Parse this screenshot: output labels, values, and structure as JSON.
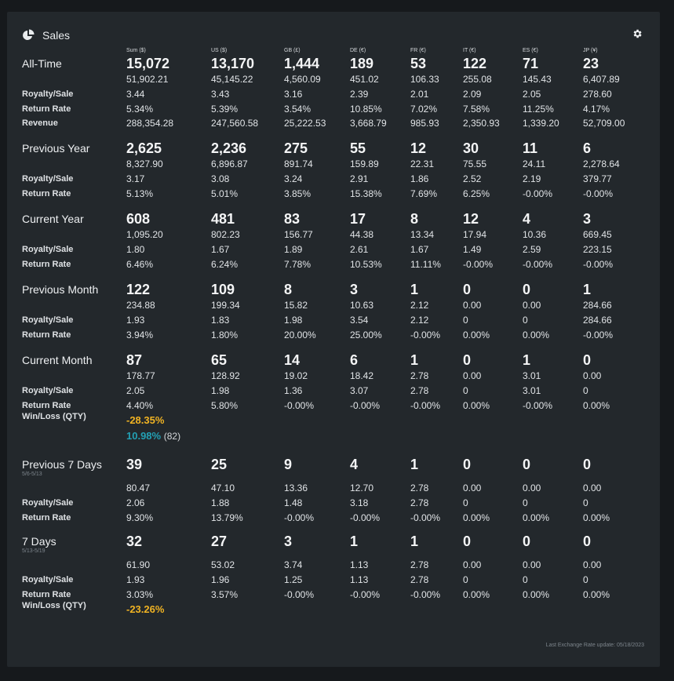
{
  "header": {
    "title": "Sales"
  },
  "columns": [
    "Sum ($)",
    "US ($)",
    "GB (£)",
    "DE (€)",
    "FR (€)",
    "IT (€)",
    "ES (€)",
    "JP (¥)"
  ],
  "groups": [
    {
      "name": "All-Time",
      "sub": "",
      "qty": [
        "15,072",
        "13,170",
        "1,444",
        "189",
        "53",
        "122",
        "71",
        "23"
      ],
      "royalty": [
        "51,902.21",
        "45,145.22",
        "4,560.09",
        "451.02",
        "106.33",
        "255.08",
        "145.43",
        "6,407.89"
      ],
      "rows": [
        {
          "label": "Royalty/Sale",
          "values": [
            "3.44",
            "3.43",
            "3.16",
            "2.39",
            "2.01",
            "2.09",
            "2.05",
            "278.60"
          ]
        },
        {
          "label": "Return Rate",
          "values": [
            "5.34%",
            "5.39%",
            "3.54%",
            "10.85%",
            "7.02%",
            "7.58%",
            "11.25%",
            "4.17%"
          ]
        },
        {
          "label": "Revenue",
          "values": [
            "288,354.28",
            "247,560.58",
            "25,222.53",
            "3,668.79",
            "985.93",
            "2,350.93",
            "1,339.20",
            "52,709.00"
          ]
        }
      ]
    },
    {
      "name": "Previous Year",
      "sub": "",
      "qty": [
        "2,625",
        "2,236",
        "275",
        "55",
        "12",
        "30",
        "11",
        "6"
      ],
      "royalty": [
        "8,327.90",
        "6,896.87",
        "891.74",
        "159.89",
        "22.31",
        "75.55",
        "24.11",
        "2,278.64"
      ],
      "rows": [
        {
          "label": "Royalty/Sale",
          "values": [
            "3.17",
            "3.08",
            "3.24",
            "2.91",
            "1.86",
            "2.52",
            "2.19",
            "379.77"
          ]
        },
        {
          "label": "Return Rate",
          "values": [
            "5.13%",
            "5.01%",
            "3.85%",
            "15.38%",
            "7.69%",
            "6.25%",
            "-0.00%",
            "-0.00%"
          ]
        }
      ]
    },
    {
      "name": "Current Year",
      "sub": "",
      "qty": [
        "608",
        "481",
        "83",
        "17",
        "8",
        "12",
        "4",
        "3"
      ],
      "royalty": [
        "1,095.20",
        "802.23",
        "156.77",
        "44.38",
        "13.34",
        "17.94",
        "10.36",
        "669.45"
      ],
      "rows": [
        {
          "label": "Royalty/Sale",
          "values": [
            "1.80",
            "1.67",
            "1.89",
            "2.61",
            "1.67",
            "1.49",
            "2.59",
            "223.15"
          ]
        },
        {
          "label": "Return Rate",
          "values": [
            "6.46%",
            "6.24%",
            "7.78%",
            "10.53%",
            "11.11%",
            "-0.00%",
            "-0.00%",
            "-0.00%"
          ]
        }
      ]
    },
    {
      "name": "Previous Month",
      "sub": "",
      "qty": [
        "122",
        "109",
        "8",
        "3",
        "1",
        "0",
        "0",
        "1"
      ],
      "royalty": [
        "234.88",
        "199.34",
        "15.82",
        "10.63",
        "2.12",
        "0.00",
        "0.00",
        "284.66"
      ],
      "rows": [
        {
          "label": "Royalty/Sale",
          "values": [
            "1.93",
            "1.83",
            "1.98",
            "3.54",
            "2.12",
            "0",
            "0",
            "284.66"
          ]
        },
        {
          "label": "Return Rate",
          "values": [
            "3.94%",
            "1.80%",
            "20.00%",
            "25.00%",
            "-0.00%",
            "0.00%",
            "0.00%",
            "-0.00%"
          ]
        }
      ]
    },
    {
      "name": "Current Month",
      "sub": "",
      "qty": [
        "87",
        "65",
        "14",
        "6",
        "1",
        "0",
        "1",
        "0"
      ],
      "royalty": [
        "178.77",
        "128.92",
        "19.02",
        "18.42",
        "2.78",
        "0.00",
        "3.01",
        "0.00"
      ],
      "rows": [
        {
          "label": "Royalty/Sale",
          "values": [
            "2.05",
            "1.98",
            "1.36",
            "3.07",
            "2.78",
            "0",
            "3.01",
            "0"
          ]
        },
        {
          "label": "Return Rate",
          "values": [
            "4.40%",
            "5.80%",
            "-0.00%",
            "-0.00%",
            "-0.00%",
            "0.00%",
            "-0.00%",
            "0.00%"
          ]
        }
      ],
      "winloss": {
        "label": "Win/Loss (QTY)",
        "neg": "-28.35%",
        "pos": "10.98%",
        "pos_paren": "(82)"
      }
    },
    {
      "name": "Previous 7 Days",
      "sub": "5/6-5/13",
      "qty": [
        "39",
        "25",
        "9",
        "4",
        "1",
        "0",
        "0",
        "0"
      ],
      "royalty": [
        "80.47",
        "47.10",
        "13.36",
        "12.70",
        "2.78",
        "0.00",
        "0.00",
        "0.00"
      ],
      "rows": [
        {
          "label": "Royalty/Sale",
          "values": [
            "2.06",
            "1.88",
            "1.48",
            "3.18",
            "2.78",
            "0",
            "0",
            "0"
          ]
        },
        {
          "label": "Return Rate",
          "values": [
            "9.30%",
            "13.79%",
            "-0.00%",
            "-0.00%",
            "-0.00%",
            "0.00%",
            "0.00%",
            "0.00%"
          ]
        }
      ]
    },
    {
      "name": "7 Days",
      "sub": "5/13-5/19",
      "qty": [
        "32",
        "27",
        "3",
        "1",
        "1",
        "0",
        "0",
        "0"
      ],
      "royalty": [
        "61.90",
        "53.02",
        "3.74",
        "1.13",
        "2.78",
        "0.00",
        "0.00",
        "0.00"
      ],
      "rows": [
        {
          "label": "Royalty/Sale",
          "values": [
            "1.93",
            "1.96",
            "1.25",
            "1.13",
            "2.78",
            "0",
            "0",
            "0"
          ]
        },
        {
          "label": "Return Rate",
          "values": [
            "3.03%",
            "3.57%",
            "-0.00%",
            "-0.00%",
            "-0.00%",
            "0.00%",
            "0.00%",
            "0.00%"
          ]
        }
      ],
      "winloss": {
        "label": "Win/Loss (QTY)",
        "neg": "-23.26%"
      }
    }
  ],
  "footer": "Last Exchange Rate update: 05/18/2023",
  "colors": {
    "positive": "#23a0b4",
    "negative": "#f0b323"
  },
  "icons": {
    "title": "pie-chart-icon",
    "settings": "gear-icon"
  }
}
